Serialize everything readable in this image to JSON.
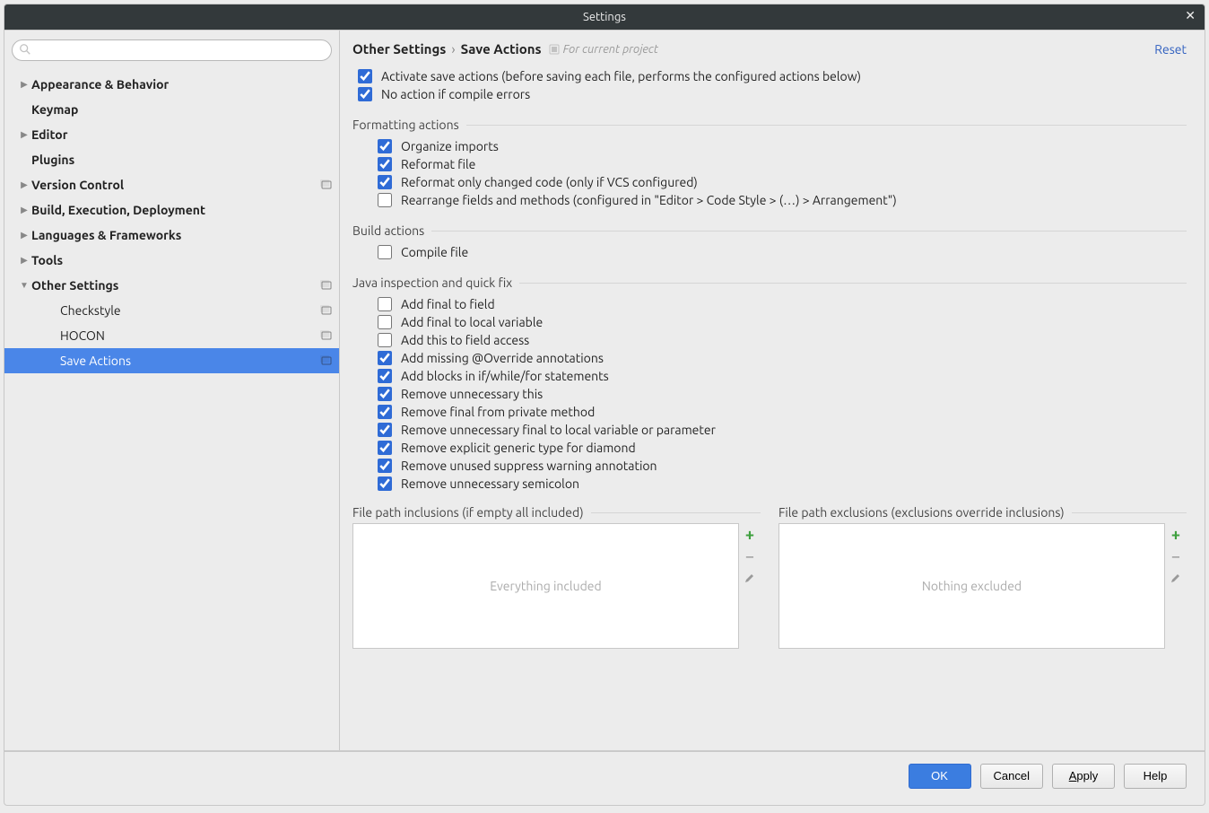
{
  "window": {
    "title": "Settings"
  },
  "sidebar": {
    "search_placeholder": "",
    "items": [
      {
        "label": "Appearance & Behavior",
        "expandable": true,
        "expanded": false,
        "bold": true,
        "badge": false
      },
      {
        "label": "Keymap",
        "expandable": false,
        "bold": true,
        "badge": false
      },
      {
        "label": "Editor",
        "expandable": true,
        "expanded": false,
        "bold": true,
        "badge": false
      },
      {
        "label": "Plugins",
        "expandable": false,
        "bold": true,
        "badge": false
      },
      {
        "label": "Version Control",
        "expandable": true,
        "expanded": false,
        "bold": true,
        "badge": true
      },
      {
        "label": "Build, Execution, Deployment",
        "expandable": true,
        "expanded": false,
        "bold": true,
        "badge": false
      },
      {
        "label": "Languages & Frameworks",
        "expandable": true,
        "expanded": false,
        "bold": true,
        "badge": false
      },
      {
        "label": "Tools",
        "expandable": true,
        "expanded": false,
        "bold": true,
        "badge": false
      },
      {
        "label": "Other Settings",
        "expandable": true,
        "expanded": true,
        "bold": true,
        "badge": true
      },
      {
        "label": "Checkstyle",
        "child": true,
        "badge": true
      },
      {
        "label": "HOCON",
        "child": true,
        "badge": true
      },
      {
        "label": "Save Actions",
        "child": true,
        "badge": true,
        "selected": true
      }
    ]
  },
  "breadcrumb": {
    "parent": "Other Settings",
    "current": "Save Actions",
    "scope": "For current project",
    "reset": "Reset"
  },
  "general": [
    {
      "label": "Activate save actions (before saving each file, performs the configured actions below)",
      "checked": true
    },
    {
      "label": "No action if compile errors",
      "checked": true
    }
  ],
  "sections": {
    "formatting": {
      "title": "Formatting actions",
      "items": [
        {
          "label": "Organize imports",
          "checked": true
        },
        {
          "label": "Reformat file",
          "checked": true
        },
        {
          "label": "Reformat only changed code (only if VCS configured)",
          "checked": true
        },
        {
          "label": "Rearrange fields and methods (configured in \"Editor > Code Style > (…) > Arrangement\")",
          "checked": false
        }
      ]
    },
    "build": {
      "title": "Build actions",
      "items": [
        {
          "label": "Compile file",
          "checked": false
        }
      ]
    },
    "java": {
      "title": "Java inspection and quick fix",
      "items": [
        {
          "label": "Add final to field",
          "checked": false
        },
        {
          "label": "Add final to local variable",
          "checked": false
        },
        {
          "label": "Add this to field access",
          "checked": false
        },
        {
          "label": "Add missing @Override annotations",
          "checked": true
        },
        {
          "label": "Add blocks in if/while/for statements",
          "checked": true
        },
        {
          "label": "Remove unnecessary this",
          "checked": true
        },
        {
          "label": "Remove final from private method",
          "checked": true
        },
        {
          "label": "Remove unnecessary final to local variable or parameter",
          "checked": true
        },
        {
          "label": "Remove explicit generic type for diamond",
          "checked": true
        },
        {
          "label": "Remove unused suppress warning annotation",
          "checked": true
        },
        {
          "label": "Remove unnecessary semicolon",
          "checked": true
        }
      ]
    }
  },
  "paths": {
    "inclusions": {
      "title": "File path inclusions (if empty all included)",
      "placeholder": "Everything included"
    },
    "exclusions": {
      "title": "File path exclusions (exclusions override inclusions)",
      "placeholder": "Nothing excluded"
    }
  },
  "footer": {
    "ok": "OK",
    "cancel": "Cancel",
    "apply": "Apply",
    "help": "Help"
  }
}
